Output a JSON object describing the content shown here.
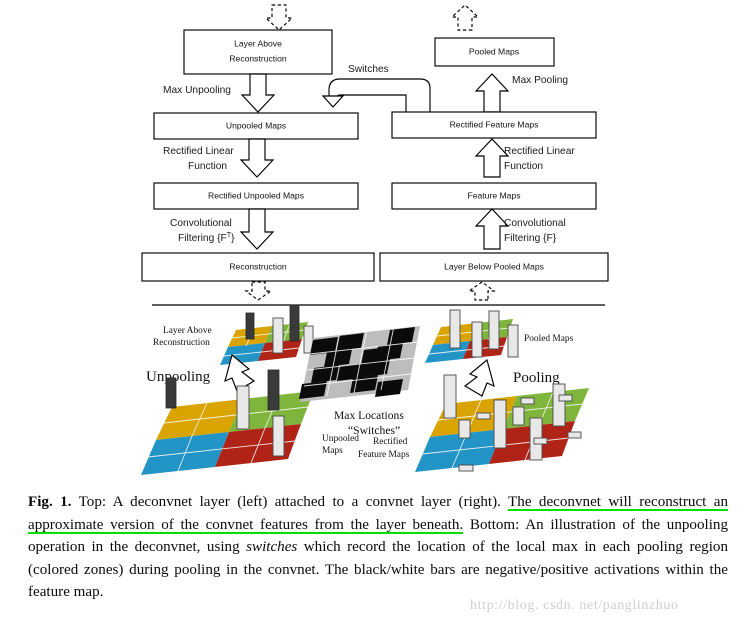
{
  "figure": {
    "top_diagram": {
      "boxes": [
        {
          "id": "layer-above-reconstruction",
          "line1": "Layer Above",
          "line2": "Reconstruction"
        },
        {
          "id": "pooled-maps",
          "line1": "Pooled Maps",
          "line2": ""
        },
        {
          "id": "unpooled-maps",
          "line1": "Unpooled Maps",
          "line2": ""
        },
        {
          "id": "rectified-feature-maps",
          "line1": "Rectified Feature Maps",
          "line2": ""
        },
        {
          "id": "rectified-unpooled-maps",
          "line1": "Rectified Unpooled Maps",
          "line2": ""
        },
        {
          "id": "feature-maps",
          "line1": "Feature Maps",
          "line2": ""
        },
        {
          "id": "reconstruction",
          "line1": "Reconstruction",
          "line2": ""
        },
        {
          "id": "layer-below-pooled-maps",
          "line1": "Layer Below Pooled Maps",
          "line2": ""
        }
      ],
      "labels": {
        "max_unpooling": "Max Unpooling",
        "switches": "Switches",
        "max_pooling": "Max Pooling",
        "rectified_linear_left_1": "Rectified Linear",
        "rectified_linear_left_2": "Function",
        "rectified_linear_right_1": "Rectified Linear",
        "rectified_linear_right_2": "Function",
        "conv_filter_left_1": "Convolutional",
        "conv_filter_left_2": "Filtering {F",
        "conv_filter_left_sup": "T",
        "conv_filter_left_3": "}",
        "conv_filter_right_1": "Convolutional",
        "conv_filter_right_2": "Filtering {F}"
      }
    },
    "bottom_illustration": {
      "layer_above_reconstruction_1": "Layer Above",
      "layer_above_reconstruction_2": "Reconstruction",
      "unpooling": "Unpooling",
      "pooling": "Pooling",
      "pooled_maps": "Pooled Maps",
      "max_locations_1": "Max Locations",
      "max_locations_2": "“Switches”",
      "unpooled_maps_1": "Unpooled",
      "unpooled_maps_2": "Maps",
      "rectified_feature_maps_1": "Rectified",
      "rectified_feature_maps_2": "Feature Maps"
    },
    "colors": {
      "gold": "#D9A400",
      "blue": "#2394C6",
      "green": "#7FB53C",
      "red": "#B02418",
      "bar_positive": "#E8E8E8",
      "bar_negative": "#3A3A3A",
      "switch_black": "#0B0B0B",
      "switch_gray": "#BDBDBD"
    }
  },
  "caption": {
    "label": "Fig. 1.",
    "part1": " Top: A deconvnet layer (left) attached to a convnet layer (right). ",
    "highlight": "The deconvnet will reconstruct an approximate version of the convnet features from the layer beneath.",
    "part2": " Bottom: An illustration of the unpooling operation in the deconvnet, using ",
    "italic1": "switches",
    "part3": " which record the location of the local max in each pooling region (colored zones) during pooling in the convnet. The black/white bars are negative/positive activations within the feature map.",
    "highlight_color": "#00E000"
  },
  "watermark": {
    "text": "http://blog. csdn. net/panglinzhuo"
  }
}
